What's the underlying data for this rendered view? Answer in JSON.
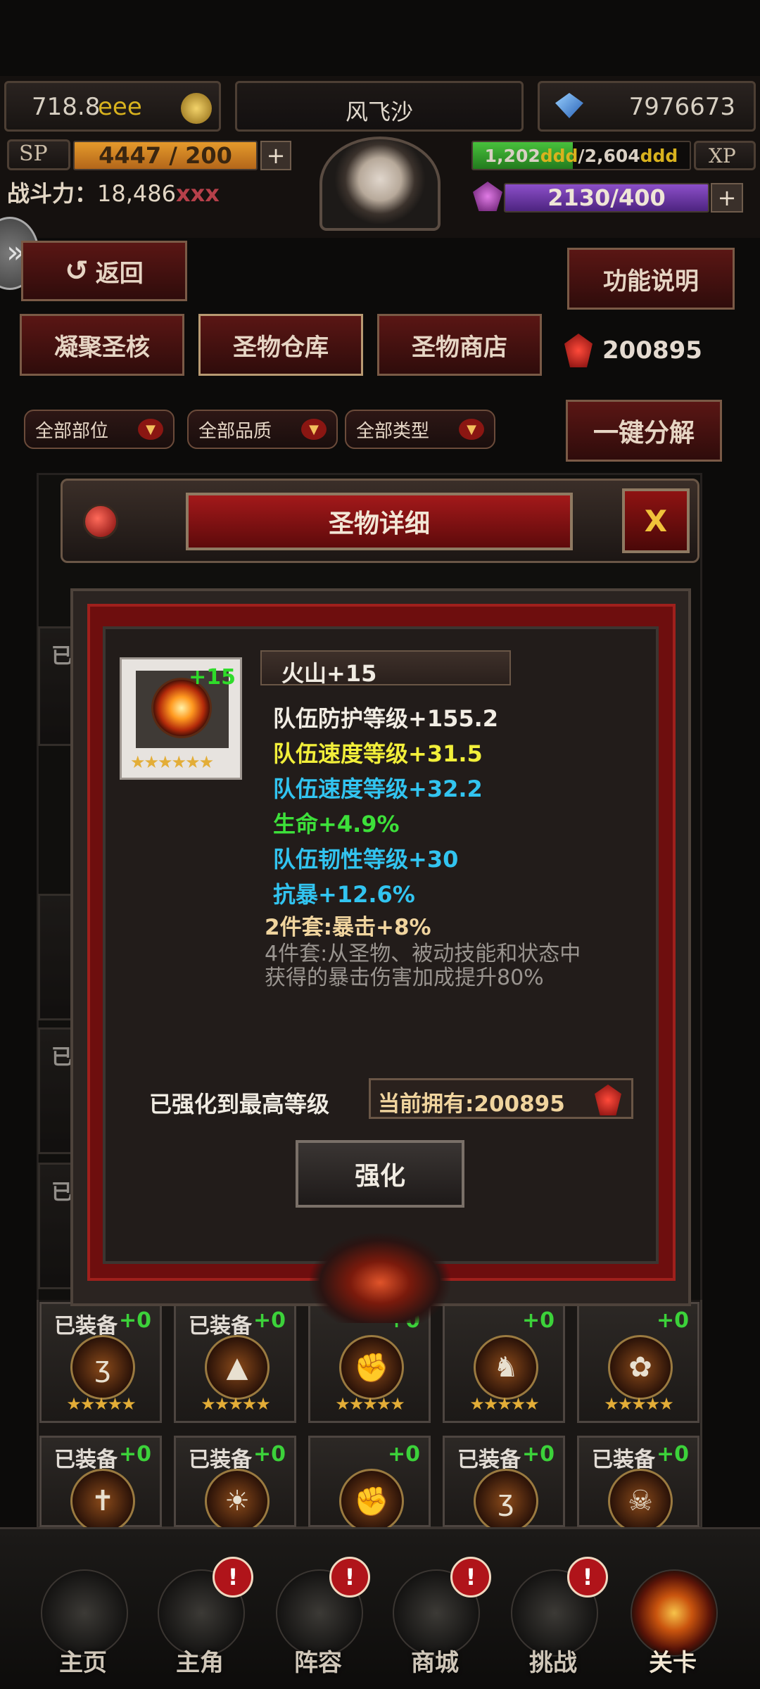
{
  "colors": {
    "white": "#f2ede4",
    "yellow": "#f2ef3a",
    "cyan": "#32c4f0",
    "green": "#3de03a",
    "tan": "#f0d49e",
    "grey": "#9a9590"
  },
  "top": {
    "gold": "718.8",
    "gold_suffix": "eee",
    "player_name": "风飞沙",
    "gems": "7976673",
    "sp_label": "SP",
    "sp_value": "4447 / 200",
    "combat_label": "战斗力：",
    "combat_value": "18,486",
    "combat_suffix": "xxx",
    "xp_current": "1,202",
    "xp_current_suffix": "ddd",
    "xp_sep": "/",
    "xp_max": "2,604",
    "xp_max_suffix": "ddd",
    "xp_label": "XP",
    "energy_value": "2130/400",
    "plus": "+"
  },
  "toolbar": {
    "back_label": "返回",
    "help_label": "功能说明",
    "tabs": [
      "凝聚圣核",
      "圣物仓库",
      "圣物商店"
    ],
    "currency": "200895",
    "filters": [
      "全部部位",
      "全部品质",
      "全部类型"
    ],
    "decompose_label": "一键分解"
  },
  "dialog": {
    "title": "圣物详细",
    "close_label": "X",
    "item_level": "+15",
    "item_stars": "★★★★★★",
    "item_name": "火山+15",
    "stats": [
      {
        "text": "队伍防护等级+155.2",
        "color": "#f2ede4"
      },
      {
        "text": "队伍速度等级+31.5",
        "color": "#f2ef3a"
      },
      {
        "text": "队伍速度等级+32.2",
        "color": "#32c4f0"
      },
      {
        "text": "生命+4.9%",
        "color": "#3de03a"
      },
      {
        "text": "队伍韧性等级+30",
        "color": "#32c4f0"
      },
      {
        "text": "抗暴+12.6%",
        "color": "#32c4f0"
      }
    ],
    "set2": "2件套:暴击+8%",
    "set4_line1": "4件套:从圣物、被动技能和状态中",
    "set4_line2": "获得的暴击伤害加成提升80%",
    "max_text": "已强化到最高等级",
    "owned_label": "当前拥有:200895",
    "enhance_label": "强化"
  },
  "grid_rows": [
    [
      {
        "tag": "已装备",
        "lvl": "+0",
        "stars": "★★★★★",
        "icon": "ʒ"
      },
      {
        "tag": "已装备",
        "lvl": "+0",
        "stars": "★★★★★",
        "icon": "▲"
      },
      {
        "tag": "",
        "lvl": "+0",
        "stars": "★★★★★",
        "icon": "✊"
      },
      {
        "tag": "",
        "lvl": "+0",
        "stars": "★★★★★",
        "icon": "♞"
      },
      {
        "tag": "",
        "lvl": "+0",
        "stars": "★★★★★",
        "icon": "✿"
      }
    ],
    [
      {
        "tag": "已装备",
        "lvl": "+0",
        "stars": "",
        "icon": "✝"
      },
      {
        "tag": "已装备",
        "lvl": "+0",
        "stars": "",
        "icon": "☀"
      },
      {
        "tag": "",
        "lvl": "+0",
        "stars": "",
        "icon": "✊"
      },
      {
        "tag": "已装备",
        "lvl": "+0",
        "stars": "",
        "icon": "ʒ"
      },
      {
        "tag": "已装备",
        "lvl": "+0",
        "stars": "",
        "icon": "☠"
      }
    ]
  ],
  "left_partial": [
    "已",
    "已",
    "已"
  ],
  "nav": {
    "items": [
      "主页",
      "主角",
      "阵容",
      "商城",
      "挑战",
      "关卡"
    ],
    "badge": "!"
  }
}
